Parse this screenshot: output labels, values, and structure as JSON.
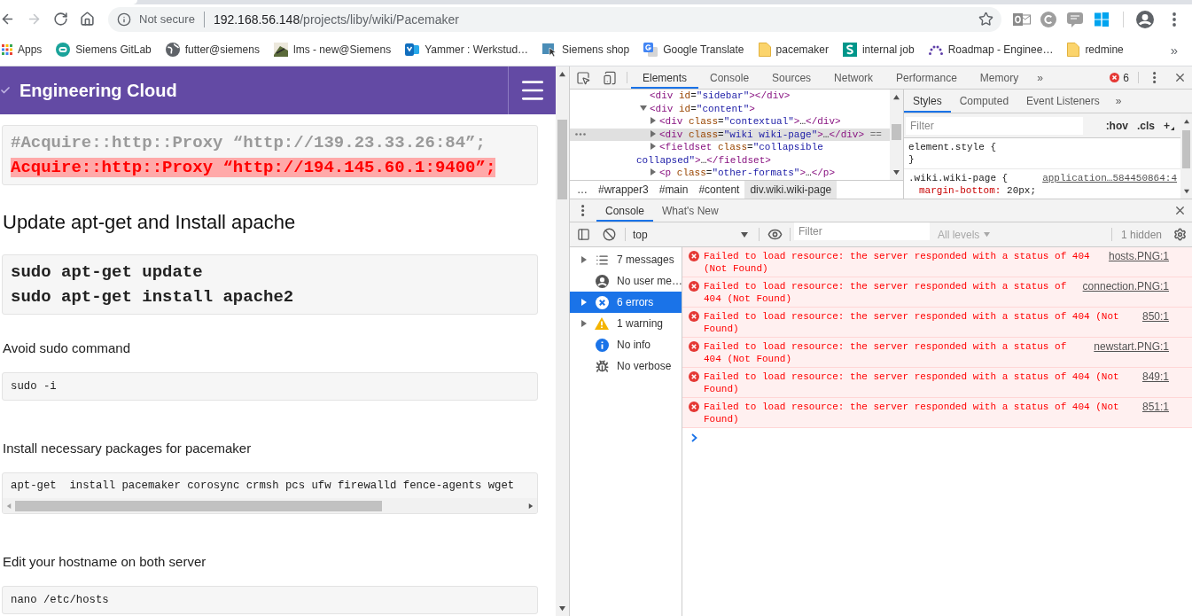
{
  "browser": {
    "nav_buttons": [
      {
        "kind": "back",
        "disabled": false
      },
      {
        "kind": "forward",
        "disabled": true
      },
      {
        "kind": "reload",
        "disabled": false
      },
      {
        "kind": "home",
        "disabled": false
      }
    ],
    "security_label": "Not secure",
    "url": {
      "host": "192.168.56.148",
      "path": "/projects/liby/wiki/Pacemaker"
    }
  },
  "bookmarks": {
    "items": [
      {
        "kind": "apps",
        "label": "Apps"
      },
      {
        "kind": "site",
        "label": "Siemens GitLab"
      },
      {
        "kind": "site",
        "label": "futter@siemens"
      },
      {
        "kind": "site",
        "label": "lms - new@Siemens"
      },
      {
        "kind": "site",
        "label": "Yammer : Werkstud…"
      },
      {
        "kind": "site",
        "label": "Siemens shop"
      },
      {
        "kind": "site",
        "label": "Google Translate"
      },
      {
        "kind": "folder",
        "label": "pacemaker"
      },
      {
        "kind": "site",
        "label": "internal job"
      },
      {
        "kind": "site",
        "label": "Roadmap - Enginee…"
      },
      {
        "kind": "folder",
        "label": "redmine"
      }
    ],
    "overflow": "»"
  },
  "page": {
    "brand": "Engineering Cloud",
    "blocks": [
      {
        "kind": "command",
        "scrollable": false,
        "lines": [
          {
            "kind": "comment",
            "text": "#Acquire::http::Proxy “http://139.23.33.26:84”;"
          },
          {
            "kind": "highlight",
            "text": "Acquire::http::Proxy “http://194.145.60.1:9400”;"
          }
        ]
      },
      {
        "kind": "heading",
        "text": "Update apt-get and Install apache"
      },
      {
        "kind": "command",
        "scrollable": false,
        "lines": [
          {
            "kind": "plain",
            "text": "sudo apt-get update"
          },
          {
            "kind": "plain",
            "text": "sudo apt-get install apache2"
          }
        ]
      },
      {
        "kind": "paragraph",
        "text": "Avoid sudo command"
      },
      {
        "kind": "code",
        "scrollable": false,
        "lines": [
          {
            "kind": "plain",
            "text": "sudo -i"
          }
        ]
      },
      {
        "kind": "paragraph",
        "text": "Install necessary packages for pacemaker"
      },
      {
        "kind": "code",
        "scrollable": true,
        "lines": [
          {
            "kind": "plain",
            "text": "apt-get  install pacemaker corosync crmsh pcs ufw firewalld fence-agents wget"
          }
        ]
      },
      {
        "kind": "paragraph",
        "text": "Edit your hostname on both server"
      },
      {
        "kind": "code",
        "scrollable": false,
        "lines": [
          {
            "kind": "plain",
            "text": "nano /etc/hosts"
          }
        ]
      }
    ]
  },
  "devtools": {
    "tabs": [
      {
        "label": "Elements",
        "selected": true
      },
      {
        "label": "Console",
        "selected": false
      },
      {
        "label": "Sources",
        "selected": false
      },
      {
        "label": "Network",
        "selected": false
      },
      {
        "label": "Performance",
        "selected": false
      },
      {
        "label": "Memory",
        "selected": false
      }
    ],
    "more_tabs": "»",
    "error_count": "6",
    "elements": {
      "dom_tree": [
        {
          "kind": "leaf",
          "selected": false,
          "tokens": [
            {
              "kind": "tag",
              "text": "<div"
            },
            {
              "kind": "attr",
              "text": " id"
            },
            {
              "kind": "text",
              "text": "="
            },
            {
              "kind": "value",
              "text": "\"sidebar\""
            },
            {
              "kind": "tag",
              "text": "></div>"
            }
          ]
        },
        {
          "kind": "parent",
          "selected": false,
          "expanded": true,
          "tokens": [
            {
              "kind": "tag",
              "text": "<div"
            },
            {
              "kind": "attr",
              "text": " id"
            },
            {
              "kind": "text",
              "text": "="
            },
            {
              "kind": "value",
              "text": "\"content\""
            },
            {
              "kind": "tag",
              "text": ">"
            }
          ],
          "children": [
            {
              "kind": "parent",
              "selected": false,
              "expanded": false,
              "tokens": [
                {
                  "kind": "tag",
                  "text": "<div"
                },
                {
                  "kind": "attr",
                  "text": " class"
                },
                {
                  "kind": "text",
                  "text": "="
                },
                {
                  "kind": "value",
                  "text": "\"contextual\""
                },
                {
                  "kind": "tag",
                  "text": ">"
                },
                {
                  "kind": "text",
                  "text": "…"
                },
                {
                  "kind": "tag",
                  "text": "</div>"
                }
              ]
            },
            {
              "kind": "parent",
              "selected": true,
              "expanded": false,
              "tokens": [
                {
                  "kind": "tag",
                  "text": "<div"
                },
                {
                  "kind": "attr",
                  "text": " class"
                },
                {
                  "kind": "text",
                  "text": "="
                },
                {
                  "kind": "value",
                  "text": "\"wiki wiki-page\""
                },
                {
                  "kind": "tag",
                  "text": ">"
                },
                {
                  "kind": "text",
                  "text": "…"
                },
                {
                  "kind": "tag",
                  "text": "</div>"
                },
                {
                  "kind": "marker",
                  "text": " =="
                }
              ]
            },
            {
              "kind": "parent",
              "selected": false,
              "expanded": false,
              "tokens": [
                {
                  "kind": "tag",
                  "text": "<fieldset"
                },
                {
                  "kind": "attr",
                  "text": " class"
                },
                {
                  "kind": "text",
                  "text": "="
                },
                {
                  "kind": "value",
                  "text": "\"collapsible collapsed\""
                },
                {
                  "kind": "tag",
                  "text": ">"
                },
                {
                  "kind": "text",
                  "text": "…"
                },
                {
                  "kind": "tag",
                  "text": "</fieldset>"
                }
              ]
            },
            {
              "kind": "parent",
              "selected": false,
              "expanded": false,
              "tokens": [
                {
                  "kind": "tag",
                  "text": "<p"
                },
                {
                  "kind": "attr",
                  "text": " class"
                },
                {
                  "kind": "text",
                  "text": "="
                },
                {
                  "kind": "value",
                  "text": "\"other-formats\""
                },
                {
                  "kind": "tag",
                  "text": ">"
                },
                {
                  "kind": "text",
                  "text": "…"
                },
                {
                  "kind": "tag",
                  "text": "</p>"
                }
              ]
            }
          ]
        }
      ],
      "breadcrumbs": [
        {
          "label": "…",
          "selected": false
        },
        {
          "label": "#wrapper3",
          "selected": false
        },
        {
          "label": "#main",
          "selected": false
        },
        {
          "label": "#content",
          "selected": false
        },
        {
          "label": "div.wiki.wiki-page",
          "selected": true
        }
      ]
    },
    "styles": {
      "tabs": [
        {
          "label": "Styles",
          "selected": true
        },
        {
          "label": "Computed",
          "selected": false
        },
        {
          "label": "Event Listeners",
          "selected": false
        }
      ],
      "more_tabs": "»",
      "filter": {
        "placeholder": "Filter"
      },
      "buttons": [
        {
          "kind": "toggle",
          "label": ":hov"
        },
        {
          "kind": "toggle",
          "label": ".cls"
        },
        {
          "kind": "menu",
          "label": "+"
        }
      ],
      "rules": [
        {
          "selector": "element.style {",
          "close": "}"
        },
        {
          "selector": ".wiki.wiki-page {",
          "source": "application…584450864:4",
          "declarations": [
            {
              "property": "margin-bottom:",
              "value": "20px;"
            }
          ]
        }
      ]
    }
  },
  "drawer": {
    "tabs": [
      {
        "label": "Console",
        "selected": true
      },
      {
        "label": "What's New",
        "selected": false
      }
    ],
    "console": {
      "context": "top",
      "filter": {
        "placeholder": "Filter"
      },
      "levels": {
        "label": "All levels",
        "disabled": true
      },
      "hidden_count": "1 hidden",
      "sidebar": [
        {
          "kind": "messages",
          "label": "7 messages",
          "expandable": true,
          "selected": false
        },
        {
          "kind": "user",
          "label": "No user me…",
          "expandable": false,
          "selected": false
        },
        {
          "kind": "errors",
          "label": "6 errors",
          "expandable": true,
          "selected": true
        },
        {
          "kind": "warnings",
          "label": "1 warning",
          "expandable": true,
          "selected": false
        },
        {
          "kind": "info",
          "label": "No info",
          "expandable": false,
          "selected": false
        },
        {
          "kind": "verbose",
          "label": "No verbose",
          "expandable": false,
          "selected": false
        }
      ],
      "messages": [
        {
          "kind": "error",
          "text": "Failed to load resource: the server responded with a status of 404 (Not Found)",
          "source": "hosts.PNG:1"
        },
        {
          "kind": "error",
          "text": "Failed to load resource: the server responded with a status of 404 (Not Found)",
          "source": "connection.PNG:1"
        },
        {
          "kind": "error",
          "text": "Failed to load resource: the server responded with a status of 404 (Not Found)",
          "source": "850:1"
        },
        {
          "kind": "error",
          "text": "Failed to load resource: the server responded with a status of 404 (Not Found)",
          "source": "newstart.PNG:1"
        },
        {
          "kind": "error",
          "text": "Failed to load resource: the server responded with a status of 404 (Not Found)",
          "source": "849:1"
        },
        {
          "kind": "error",
          "text": "Failed to load resource: the server responded with a status of 404 (Not Found)",
          "source": "851:1"
        }
      ]
    }
  }
}
